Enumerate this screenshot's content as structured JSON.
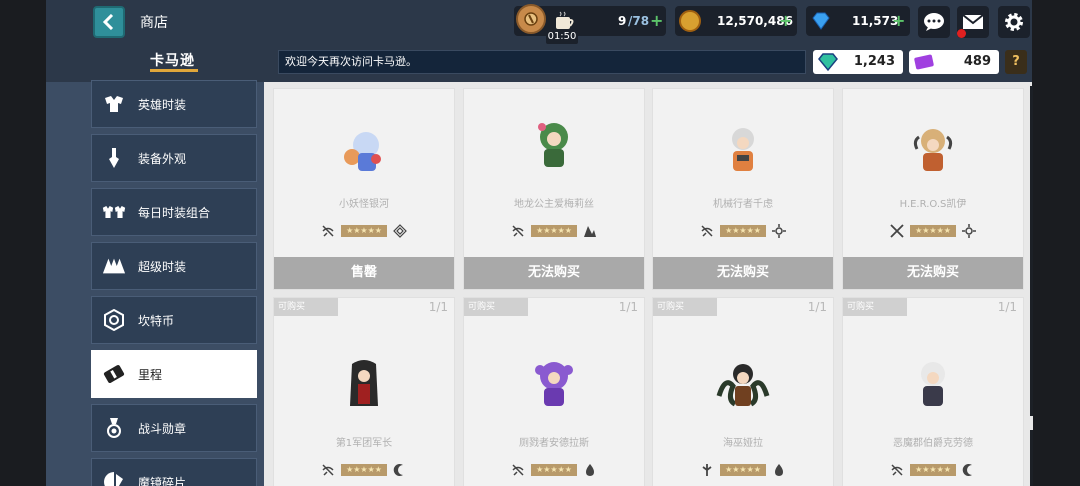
{
  "header": {
    "back_label": "‹",
    "title": "商店",
    "brand": "卡马逊",
    "notice": "欢迎今天再次访问卡马逊。",
    "stamina": {
      "value": "9",
      "max": "/78",
      "timer": "01:50"
    },
    "gold": {
      "value": "12,570,486"
    },
    "gems": {
      "value": "11,573"
    },
    "currency_a": {
      "value": "1,243"
    },
    "currency_b": {
      "value": "489"
    },
    "help": "?"
  },
  "colors": {
    "accent_teal": "#2f8f9a",
    "plus_green": "#5cc46a",
    "gold_underline": "#e0a63a"
  },
  "sidebar": {
    "items": [
      {
        "label": "英雄时装",
        "icon": "costume-icon"
      },
      {
        "label": "装备外观",
        "icon": "equipment-skin-icon"
      },
      {
        "label": "每日时装组合",
        "icon": "daily-bundle-icon"
      },
      {
        "label": "超级时装",
        "icon": "super-costume-icon"
      },
      {
        "label": "坎特币",
        "icon": "kanter-coin-icon"
      },
      {
        "label": "里程",
        "icon": "mileage-icon",
        "active": true
      },
      {
        "label": "战斗勋章",
        "icon": "medal-icon"
      },
      {
        "label": "魔镜碎片",
        "icon": "mirror-shard-icon"
      }
    ]
  },
  "cards_row1": [
    {
      "name": "小妖怪银河",
      "button": "售罄"
    },
    {
      "name": "地龙公主爱梅莉丝",
      "button": "无法购买"
    },
    {
      "name": "机械行者千虑",
      "button": "无法购买"
    },
    {
      "name": "H.E.R.O.S凯伊",
      "button": "无法购买"
    }
  ],
  "cards_row2": [
    {
      "name": "第1军团军长",
      "tag": "可购买",
      "count": "1/1"
    },
    {
      "name": "厕戮者安德拉斯",
      "tag": "可购买",
      "count": "1/1"
    },
    {
      "name": "海巫娅拉",
      "tag": "可购买",
      "count": "1/1"
    },
    {
      "name": "恶魔郡伯爵克劳德",
      "tag": "可购买",
      "count": "1/1"
    }
  ],
  "stars": "★★★★★"
}
